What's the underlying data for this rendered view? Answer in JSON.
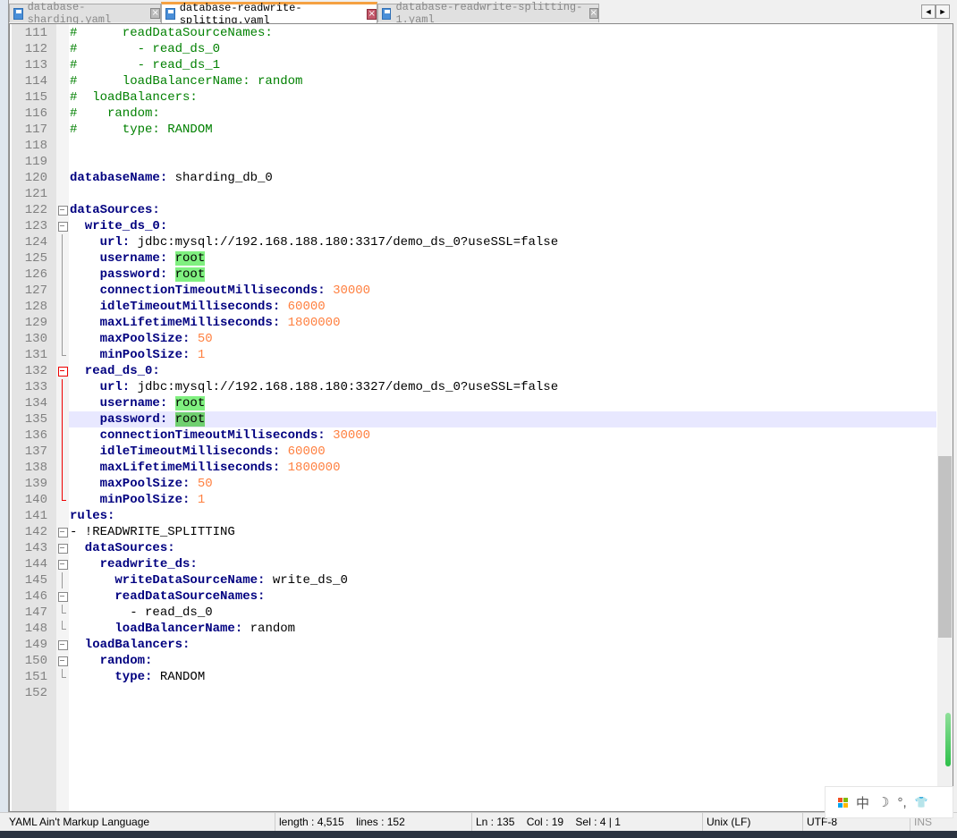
{
  "tabs": [
    {
      "label": "database-sharding.yaml",
      "active": false
    },
    {
      "label": "database-readwrite-splitting.yaml",
      "active": true
    },
    {
      "label": "database-readwrite-splitting-1.yaml",
      "active": false
    }
  ],
  "nav": {
    "prev": "◄",
    "next": "►"
  },
  "current_line": 135,
  "lines": [
    {
      "n": 111,
      "fold": "",
      "s": [
        [
          "c",
          "#      readDataSourceNames:"
        ]
      ]
    },
    {
      "n": 112,
      "fold": "",
      "s": [
        [
          "c",
          "#        - read_ds_0"
        ]
      ]
    },
    {
      "n": 113,
      "fold": "",
      "s": [
        [
          "c",
          "#        - read_ds_1"
        ]
      ]
    },
    {
      "n": 114,
      "fold": "",
      "s": [
        [
          "c",
          "#      loadBalancerName: random"
        ]
      ]
    },
    {
      "n": 115,
      "fold": "",
      "s": [
        [
          "c",
          "#  loadBalancers:"
        ]
      ]
    },
    {
      "n": 116,
      "fold": "",
      "s": [
        [
          "c",
          "#    random:"
        ]
      ]
    },
    {
      "n": 117,
      "fold": "",
      "s": [
        [
          "c",
          "#      type: RANDOM"
        ]
      ]
    },
    {
      "n": 118,
      "fold": "",
      "s": []
    },
    {
      "n": 119,
      "fold": "",
      "s": []
    },
    {
      "n": 120,
      "fold": "",
      "s": [
        [
          "k",
          "databaseName:"
        ],
        [
          "v",
          " sharding_db_0"
        ]
      ]
    },
    {
      "n": 121,
      "fold": "",
      "s": []
    },
    {
      "n": 122,
      "fold": "box",
      "s": [
        [
          "k",
          "dataSources:"
        ]
      ]
    },
    {
      "n": 123,
      "fold": "box",
      "s": [
        [
          "k",
          "  write_ds_0:"
        ]
      ]
    },
    {
      "n": 124,
      "fold": "line",
      "s": [
        [
          "k",
          "    url:"
        ],
        [
          "v",
          " jdbc:mysql://192.168.188.180:3317/demo_ds_0?useSSL=false"
        ]
      ]
    },
    {
      "n": 125,
      "fold": "line",
      "s": [
        [
          "k",
          "    username:"
        ],
        [
          "v",
          " "
        ],
        [
          "hl",
          "root"
        ]
      ]
    },
    {
      "n": 126,
      "fold": "line",
      "s": [
        [
          "k",
          "    password:"
        ],
        [
          "v",
          " "
        ],
        [
          "hl",
          "root"
        ]
      ]
    },
    {
      "n": 127,
      "fold": "line",
      "s": [
        [
          "k",
          "    connectionTimeoutMilliseconds:"
        ],
        [
          "v",
          " "
        ],
        [
          "n",
          "30000"
        ]
      ]
    },
    {
      "n": 128,
      "fold": "line",
      "s": [
        [
          "k",
          "    idleTimeoutMilliseconds:"
        ],
        [
          "v",
          " "
        ],
        [
          "n",
          "60000"
        ]
      ]
    },
    {
      "n": 129,
      "fold": "line",
      "s": [
        [
          "k",
          "    maxLifetimeMilliseconds:"
        ],
        [
          "v",
          " "
        ],
        [
          "n",
          "1800000"
        ]
      ]
    },
    {
      "n": 130,
      "fold": "line",
      "s": [
        [
          "k",
          "    maxPoolSize:"
        ],
        [
          "v",
          " "
        ],
        [
          "n",
          "50"
        ]
      ]
    },
    {
      "n": 131,
      "fold": "end",
      "s": [
        [
          "k",
          "    minPoolSize:"
        ],
        [
          "v",
          " "
        ],
        [
          "n",
          "1"
        ]
      ]
    },
    {
      "n": 132,
      "fold": "box red",
      "s": [
        [
          "k",
          "  read_ds_0:"
        ]
      ]
    },
    {
      "n": 133,
      "fold": "line red",
      "s": [
        [
          "k",
          "    url:"
        ],
        [
          "v",
          " jdbc:mysql://192.168.188.180:3327/demo_ds_0?useSSL=false"
        ]
      ]
    },
    {
      "n": 134,
      "fold": "line red",
      "s": [
        [
          "k",
          "    username:"
        ],
        [
          "v",
          " "
        ],
        [
          "hl",
          "root"
        ]
      ]
    },
    {
      "n": 135,
      "fold": "line red",
      "s": [
        [
          "k",
          "    password:"
        ],
        [
          "v",
          " "
        ],
        [
          "hl2",
          "root"
        ]
      ]
    },
    {
      "n": 136,
      "fold": "line red",
      "s": [
        [
          "k",
          "    connectionTimeoutMilliseconds:"
        ],
        [
          "v",
          " "
        ],
        [
          "n",
          "30000"
        ]
      ]
    },
    {
      "n": 137,
      "fold": "line red",
      "s": [
        [
          "k",
          "    idleTimeoutMilliseconds:"
        ],
        [
          "v",
          " "
        ],
        [
          "n",
          "60000"
        ]
      ]
    },
    {
      "n": 138,
      "fold": "line red",
      "s": [
        [
          "k",
          "    maxLifetimeMilliseconds:"
        ],
        [
          "v",
          " "
        ],
        [
          "n",
          "1800000"
        ]
      ]
    },
    {
      "n": 139,
      "fold": "line red",
      "s": [
        [
          "k",
          "    maxPoolSize:"
        ],
        [
          "v",
          " "
        ],
        [
          "n",
          "50"
        ]
      ]
    },
    {
      "n": 140,
      "fold": "end red",
      "s": [
        [
          "k",
          "    minPoolSize:"
        ],
        [
          "v",
          " "
        ],
        [
          "n",
          "1"
        ]
      ]
    },
    {
      "n": 141,
      "fold": "",
      "s": [
        [
          "k",
          "rules:"
        ]
      ]
    },
    {
      "n": 142,
      "fold": "box",
      "s": [
        [
          "v",
          "- !READWRITE_SPLITTING"
        ]
      ]
    },
    {
      "n": 143,
      "fold": "box",
      "s": [
        [
          "k",
          "  dataSources:"
        ]
      ]
    },
    {
      "n": 144,
      "fold": "box",
      "s": [
        [
          "k",
          "    readwrite_ds:"
        ]
      ]
    },
    {
      "n": 145,
      "fold": "line",
      "s": [
        [
          "k",
          "      writeDataSourceName:"
        ],
        [
          "v",
          " write_ds_0"
        ]
      ]
    },
    {
      "n": 146,
      "fold": "box",
      "s": [
        [
          "k",
          "      readDataSourceNames:"
        ]
      ]
    },
    {
      "n": 147,
      "fold": "end",
      "s": [
        [
          "v",
          "        - read_ds_0"
        ]
      ]
    },
    {
      "n": 148,
      "fold": "end",
      "s": [
        [
          "k",
          "      loadBalancerName:"
        ],
        [
          "v",
          " random"
        ]
      ]
    },
    {
      "n": 149,
      "fold": "box",
      "s": [
        [
          "k",
          "  loadBalancers:"
        ]
      ]
    },
    {
      "n": 150,
      "fold": "box",
      "s": [
        [
          "k",
          "    random:"
        ]
      ]
    },
    {
      "n": 151,
      "fold": "end",
      "s": [
        [
          "k",
          "      type:"
        ],
        [
          "v",
          " RANDOM"
        ]
      ]
    },
    {
      "n": 152,
      "fold": "",
      "s": []
    }
  ],
  "status": {
    "language": "YAML Ain't Markup Language",
    "length": "length : 4,515",
    "lines": "lines : 152",
    "ln": "Ln : 135",
    "col": "Col : 19",
    "sel": "Sel : 4 | 1",
    "eol": "Unix (LF)",
    "encoding": "UTF-8",
    "mode": "INS"
  },
  "ime": {
    "lang": "中",
    "moon": "☽",
    "punct": "°,",
    "skin": "👕"
  }
}
